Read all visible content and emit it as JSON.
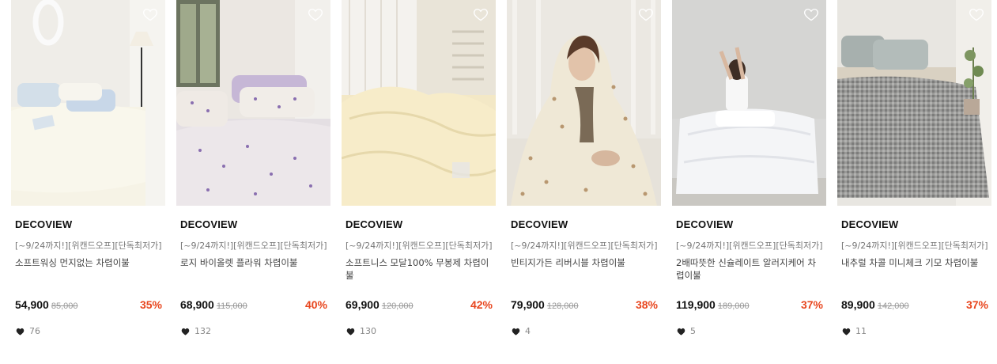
{
  "products": [
    {
      "brand": "DECOVIEW",
      "promo": "[~9/24까지!][위캔드오프][단독최저가]",
      "name": "소프트워싱 먼지없는 차렵이불",
      "price": "54,900",
      "original_price": "85,000",
      "discount": "35%",
      "likes": "76",
      "image_palette": {
        "wall": "#eeece6",
        "bed": "#f6f3e6",
        "accent": "#cfdcea"
      }
    },
    {
      "brand": "DECOVIEW",
      "promo": "[~9/24까지!][위캔드오프][단독최저가]",
      "name": "로지 바이올렛 플라워 차렵이불",
      "price": "68,900",
      "original_price": "115,000",
      "discount": "40%",
      "likes": "132",
      "image_palette": {
        "wall": "#e9e5e1",
        "bed": "#e8e2e4",
        "accent": "#c9bcd9"
      }
    },
    {
      "brand": "DECOVIEW",
      "promo": "[~9/24까지!][위캔드오프][단독최저가]",
      "name": "소프트니스 모달100% 무봉제 차렵이불",
      "price": "69,900",
      "original_price": "120,000",
      "discount": "42%",
      "likes": "130",
      "image_palette": {
        "wall": "#e8e3d6",
        "bed": "#f3e8c4",
        "accent": "#eadcae"
      }
    },
    {
      "brand": "DECOVIEW",
      "promo": "[~9/24까지!][위캔드오프][단독최저가]",
      "name": "빈티지가든 리버시블 차렵이불",
      "price": "79,900",
      "original_price": "128,000",
      "discount": "38%",
      "likes": "4",
      "image_palette": {
        "wall": "#e7e3dc",
        "bed": "#efe8d6",
        "accent": "#b7a07a"
      }
    },
    {
      "brand": "DECOVIEW",
      "promo": "[~9/24까지!][위캔드오프][단독최저가]",
      "name": "2배따뜻한 신슐레이트 알러지케어 차렵이불",
      "price": "119,900",
      "original_price": "189,000",
      "discount": "37%",
      "likes": "5",
      "image_palette": {
        "wall": "#dcdcdc",
        "bed": "#f4f5f7",
        "accent": "#c9ccd2"
      }
    },
    {
      "brand": "DECOVIEW",
      "promo": "[~9/24까지!][위캔드오프][단독최저가]",
      "name": "내추럴 차콜 미니체크 기모 차렵이불",
      "price": "89,900",
      "original_price": "142,000",
      "discount": "37%",
      "likes": "11",
      "image_palette": {
        "wall": "#e6e4df",
        "bed": "#8e8e8c",
        "accent": "#aab3b2"
      }
    }
  ],
  "colors": {
    "discount": "#e8461e",
    "price": "#111111",
    "muted": "#999999"
  },
  "icons": {
    "wishlist": "heart-outline-icon",
    "likes": "heart-filled-icon"
  }
}
